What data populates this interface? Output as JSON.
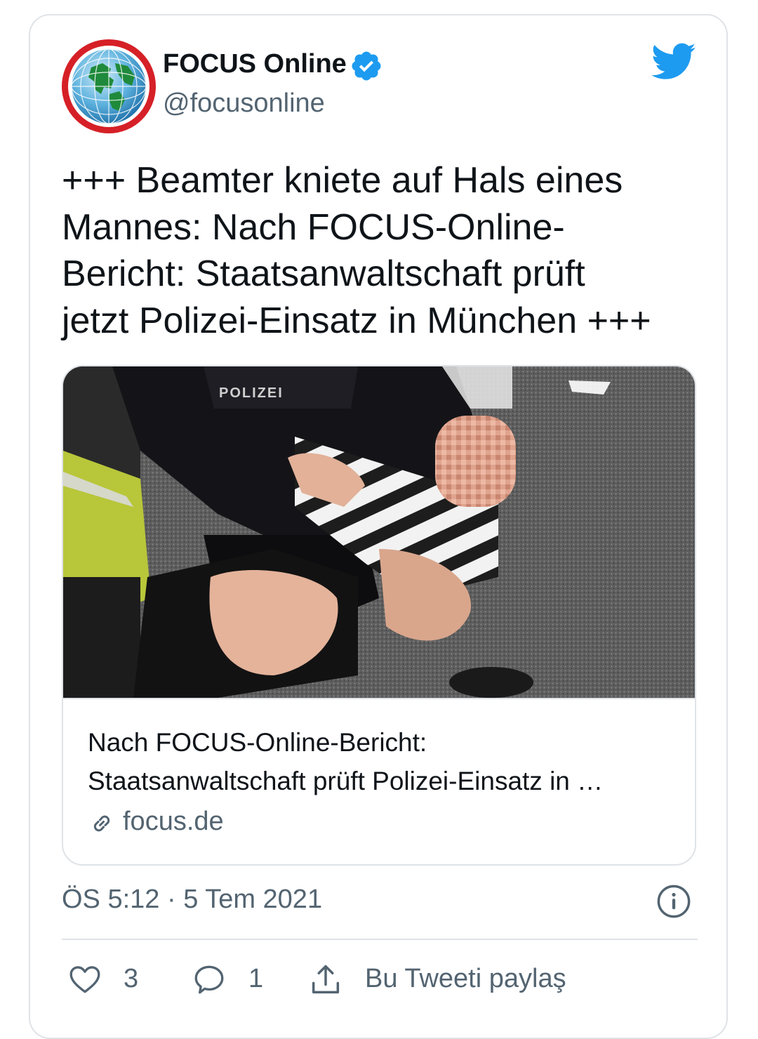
{
  "account": {
    "display_name": "FOCUS Online",
    "handle": "@focusonline",
    "verified": true,
    "avatar_icon": "globe-logo",
    "platform_icon": "twitter-bird-icon"
  },
  "tweet": {
    "text_lines": [
      "+++ Beamter kniete auf Hals eines",
      "Mannes: Nach FOCUS-Online-",
      "Bericht: Staatsanwaltschaft prüft",
      "jetzt Polizei-Einsatz in München +++"
    ],
    "timestamp": "ÖS 5:12 · 5 Tem 2021"
  },
  "link_card": {
    "image_label": "POLIZEI",
    "title_lines": [
      "Nach FOCUS-Online-Bericht:",
      "Staatsanwaltschaft prüft Polizei-Einsatz in …"
    ],
    "domain": "focus.de",
    "domain_icon": "link-icon"
  },
  "actions": {
    "like_count": "3",
    "reply_count": "1",
    "share_label": "Bu Tweeti paylaş"
  },
  "colors": {
    "text": "#0f1419",
    "secondary": "#536471",
    "border": "#dfe3e7",
    "accent": "#1d9bf0",
    "avatar_ring": "#d62027"
  }
}
